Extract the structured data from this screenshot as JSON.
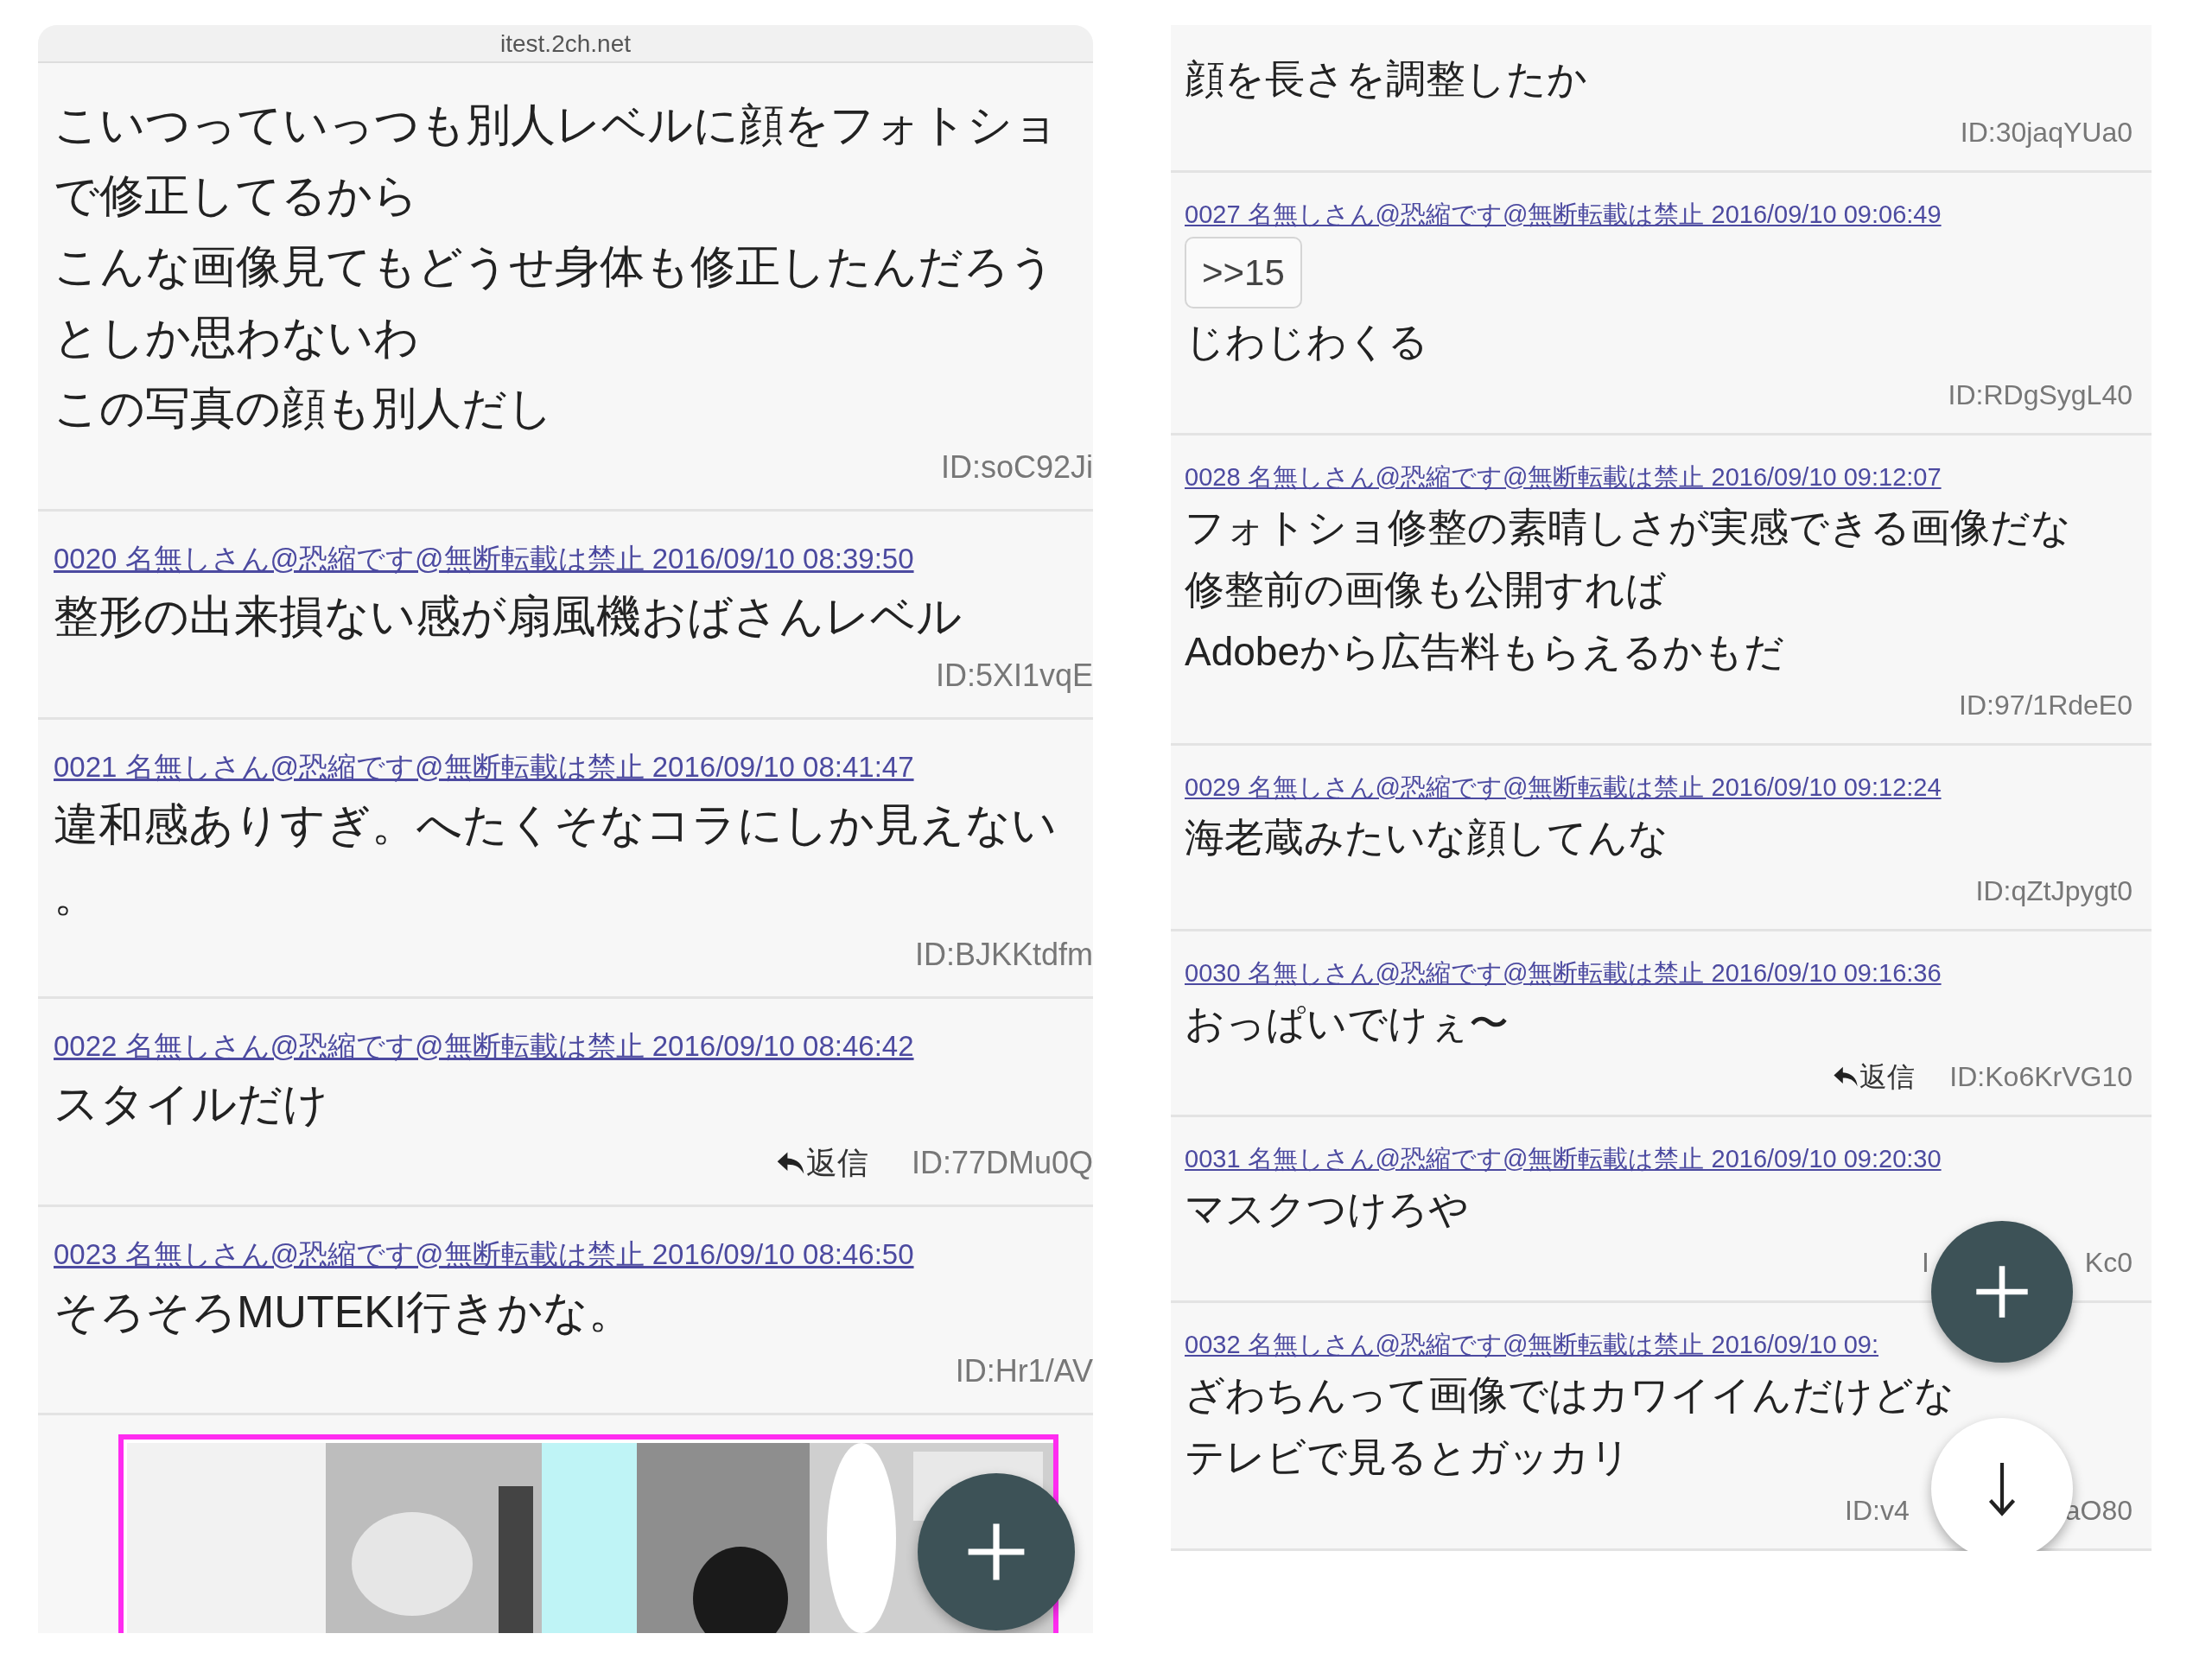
{
  "panels": [
    {
      "url": "itest.2ch.net",
      "posts": [
        {
          "body": [
            "こいつっていっつも別人レベルに顔をフォトショ",
            "で修正してるから",
            "こんな画像見てもどうせ身体も修正したんだろう",
            "としか思わないわ",
            "この写真の顔も別人だし"
          ],
          "id": "ID:soC92Ji"
        },
        {
          "meta": "0020 名無しさん@恐縮です@無断転載は禁止 2016/09/10 08:39:50",
          "body": [
            "整形の出来損ない感が扇風機おばさんレベル"
          ],
          "id": "ID:5XI1vqE"
        },
        {
          "meta": "0021 名無しさん@恐縮です@無断転載は禁止 2016/09/10 08:41:47",
          "body": [
            "違和感ありすぎ。へたくそなコラにしか見えない",
            "。"
          ],
          "id": "ID:BJKKtdfm"
        },
        {
          "meta": "0022 名無しさん@恐縮です@無断転載は禁止 2016/09/10 08:46:42",
          "body": [
            "スタイルだけ"
          ],
          "reply": "返信",
          "id": "ID:77DMu0Q"
        },
        {
          "meta": "0023 名無しさん@恐縮です@無断転載は禁止 2016/09/10 08:46:50",
          "body": [
            "そろそろMUTEKI行きかな。"
          ],
          "id": "ID:Hr1/AV"
        }
      ],
      "picture": {
        "kind": "picture"
      },
      "fabs": [
        {
          "kind": "add"
        }
      ]
    },
    {
      "posts": [
        {
          "body": [
            "顔を長さを調整したか"
          ],
          "id": "ID:30jaqYUa0"
        },
        {
          "meta": "0027 名無しさん@恐縮です@無断転載は禁止 2016/09/10 09:06:49",
          "quote": ">>15",
          "body": [
            "じわじわくる"
          ],
          "id": "ID:RDgSygL40"
        },
        {
          "meta": "0028 名無しさん@恐縮です@無断転載は禁止 2016/09/10 09:12:07",
          "body": [
            "フォトショ修整の素晴しさが実感できる画像だな",
            "修整前の画像も公開すれば",
            "Adobeから広告料もらえるかもだ"
          ],
          "id": "ID:97/1RdeE0"
        },
        {
          "meta": "0029 名無しさん@恐縮です@無断転載は禁止 2016/09/10 09:12:24",
          "body": [
            "海老蔵みたいな顔してんな"
          ],
          "id": "ID:qZtJpygt0"
        },
        {
          "meta": "0030 名無しさん@恐縮です@無断転載は禁止 2016/09/10 09:16:36",
          "body": [
            "おっぱいでけぇ〜"
          ],
          "reply": "返信",
          "id": "ID:Ko6KrVG10"
        },
        {
          "meta": "0031 名無しさん@恐縮です@無断転載は禁止 2016/09/10 09:20:30",
          "body": [
            "マスクつけろや"
          ],
          "id_parts": [
            "I",
            "Kc0"
          ]
        },
        {
          "meta": "0032 名無しさん@恐縮です@無断転載は禁止 2016/09/10 09:",
          "body": [
            "ざわちんって画像ではカワイイんだけどな",
            "テレビで見るとガッカリ"
          ],
          "id_parts": [
            "ID:v4",
            "aO80"
          ]
        }
      ],
      "fabs": [
        {
          "kind": "add"
        },
        {
          "kind": "down"
        }
      ]
    }
  ]
}
